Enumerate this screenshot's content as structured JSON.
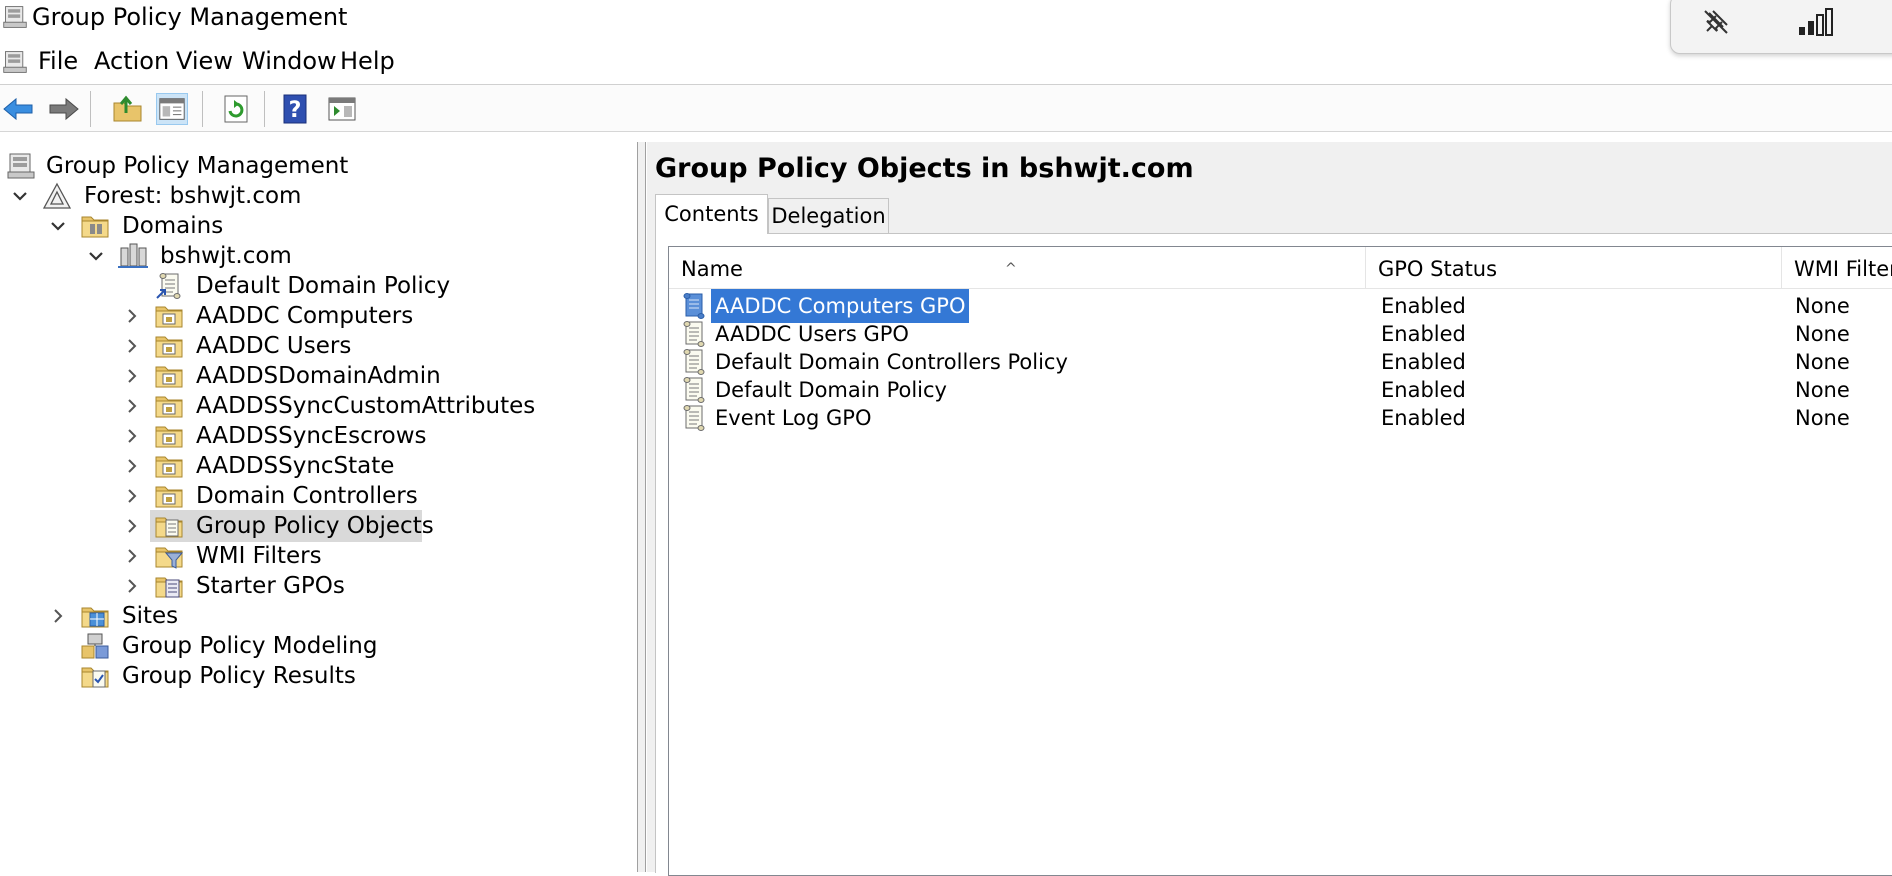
{
  "window": {
    "title": "Group Policy Management"
  },
  "menu": [
    "File",
    "Action",
    "View",
    "Window",
    "Help"
  ],
  "toolbar": {
    "buttons": [
      "back-icon",
      "forward-icon",
      "up-folder-icon",
      "show-hide-tree-icon",
      "refresh-icon",
      "help-icon",
      "action-pane-icon"
    ]
  },
  "tree": {
    "root": "Group Policy Management",
    "forest": "Forest: bshwjt.com",
    "domains": "Domains",
    "domain": "bshwjt.com",
    "domain_children": [
      "Default Domain Policy",
      "AADDC Computers",
      "AADDC Users",
      "AADDSDomainAdmin",
      "AADDSSyncCustomAttributes",
      "AADDSSyncEscrows",
      "AADDSSyncState",
      "Domain Controllers",
      "Group Policy Objects",
      "WMI Filters",
      "Starter GPOs"
    ],
    "selected": "Group Policy Objects",
    "sites": "Sites",
    "modeling": "Group Policy Modeling",
    "results": "Group Policy Results"
  },
  "details": {
    "title": "Group Policy Objects in bshwjt.com",
    "tabs": [
      "Contents",
      "Delegation"
    ],
    "active_tab": "Contents",
    "columns": [
      "Name",
      "GPO Status",
      "WMI Filter"
    ],
    "sort_indicator": "^",
    "rows": [
      {
        "name": "AADDC Computers GPO",
        "status": "Enabled",
        "wmi": "None",
        "selected": true
      },
      {
        "name": "AADDC Users GPO",
        "status": "Enabled",
        "wmi": "None"
      },
      {
        "name": "Default Domain Controllers Policy",
        "status": "Enabled",
        "wmi": "None"
      },
      {
        "name": "Default Domain Policy",
        "status": "Enabled",
        "wmi": "None"
      },
      {
        "name": "Event Log GPO",
        "status": "Enabled",
        "wmi": "None"
      }
    ]
  },
  "colors": {
    "selection": "#3478d5",
    "tree_selection": "#d9d9d9",
    "pane_bg": "#f0f0f0"
  }
}
